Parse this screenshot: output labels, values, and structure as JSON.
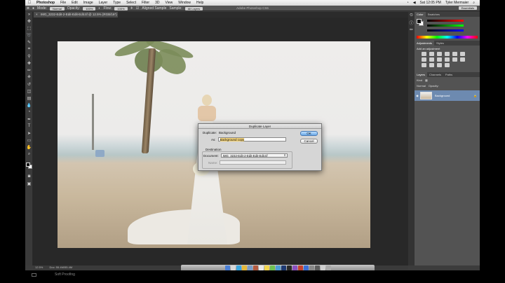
{
  "menubar": {
    "app_name": "Photoshop",
    "items": [
      "File",
      "Edit",
      "Image",
      "Layer",
      "Type",
      "Select",
      "Filter",
      "3D",
      "View",
      "Window",
      "Help"
    ],
    "clock": "Sat 12:05 PM",
    "user": "Tyler Mermaier"
  },
  "app_title": "Adobe Photoshop CS6",
  "options": {
    "mode_label": "Mode:",
    "mode_value": "Normal",
    "opacity_label": "Opacity:",
    "opacity_value": "100%",
    "flow_label": "Flow:",
    "flow_value": "100%",
    "aligned_label": "Aligned Sample",
    "sample_value": "All Layers",
    "workspace": "Essentials"
  },
  "document": {
    "tab_title": "IMG_3232-Edit-2-Edit-Edit-Edit.tif @ 12.5% (RGB/16*)"
  },
  "dialog": {
    "title": "Duplicate Layer",
    "duplicate_label": "Duplicate:",
    "duplicate_value": "Background",
    "as_label": "As:",
    "as_value": "Background copy",
    "ok": "OK",
    "cancel": "Cancel",
    "destination_label": "Destination",
    "document_label": "Document:",
    "document_value": "IMG_3232-Edit-2-Edit-Edit-Edit.tif",
    "name_label": "Name:"
  },
  "status": {
    "zoom": "12.5%",
    "doc": "Doc: 55.4M/55.4M"
  },
  "panels": {
    "color_tabs": [
      "Color",
      "Swatches"
    ],
    "adjust_tabs": [
      "Adjustments",
      "Styles"
    ],
    "adjust_label": "Add an adjustment",
    "layer_tabs": [
      "Layers",
      "Channels",
      "Paths"
    ],
    "kind_label": "Kind",
    "blend_mode": "Normal",
    "opacity_label": "Opacity:",
    "lock_label": "Lock:",
    "fill_label": "Fill:",
    "layer_name": "Background"
  },
  "footer": {
    "text": "Soft Proofing"
  }
}
